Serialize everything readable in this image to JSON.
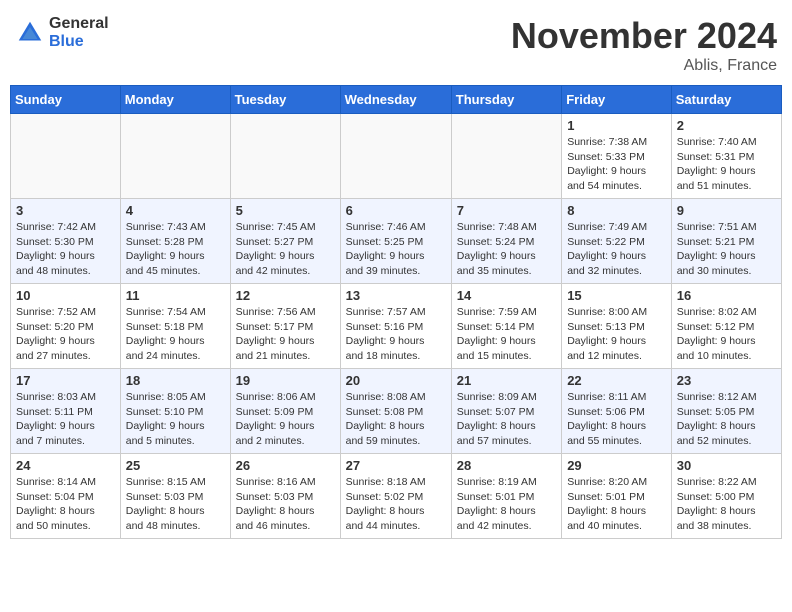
{
  "header": {
    "logo_general": "General",
    "logo_blue": "Blue",
    "month_title": "November 2024",
    "location": "Ablis, France"
  },
  "weekdays": [
    "Sunday",
    "Monday",
    "Tuesday",
    "Wednesday",
    "Thursday",
    "Friday",
    "Saturday"
  ],
  "weeks": [
    [
      {
        "day": "",
        "info": ""
      },
      {
        "day": "",
        "info": ""
      },
      {
        "day": "",
        "info": ""
      },
      {
        "day": "",
        "info": ""
      },
      {
        "day": "",
        "info": ""
      },
      {
        "day": "1",
        "info": "Sunrise: 7:38 AM\nSunset: 5:33 PM\nDaylight: 9 hours\nand 54 minutes."
      },
      {
        "day": "2",
        "info": "Sunrise: 7:40 AM\nSunset: 5:31 PM\nDaylight: 9 hours\nand 51 minutes."
      }
    ],
    [
      {
        "day": "3",
        "info": "Sunrise: 7:42 AM\nSunset: 5:30 PM\nDaylight: 9 hours\nand 48 minutes."
      },
      {
        "day": "4",
        "info": "Sunrise: 7:43 AM\nSunset: 5:28 PM\nDaylight: 9 hours\nand 45 minutes."
      },
      {
        "day": "5",
        "info": "Sunrise: 7:45 AM\nSunset: 5:27 PM\nDaylight: 9 hours\nand 42 minutes."
      },
      {
        "day": "6",
        "info": "Sunrise: 7:46 AM\nSunset: 5:25 PM\nDaylight: 9 hours\nand 39 minutes."
      },
      {
        "day": "7",
        "info": "Sunrise: 7:48 AM\nSunset: 5:24 PM\nDaylight: 9 hours\nand 35 minutes."
      },
      {
        "day": "8",
        "info": "Sunrise: 7:49 AM\nSunset: 5:22 PM\nDaylight: 9 hours\nand 32 minutes."
      },
      {
        "day": "9",
        "info": "Sunrise: 7:51 AM\nSunset: 5:21 PM\nDaylight: 9 hours\nand 30 minutes."
      }
    ],
    [
      {
        "day": "10",
        "info": "Sunrise: 7:52 AM\nSunset: 5:20 PM\nDaylight: 9 hours\nand 27 minutes."
      },
      {
        "day": "11",
        "info": "Sunrise: 7:54 AM\nSunset: 5:18 PM\nDaylight: 9 hours\nand 24 minutes."
      },
      {
        "day": "12",
        "info": "Sunrise: 7:56 AM\nSunset: 5:17 PM\nDaylight: 9 hours\nand 21 minutes."
      },
      {
        "day": "13",
        "info": "Sunrise: 7:57 AM\nSunset: 5:16 PM\nDaylight: 9 hours\nand 18 minutes."
      },
      {
        "day": "14",
        "info": "Sunrise: 7:59 AM\nSunset: 5:14 PM\nDaylight: 9 hours\nand 15 minutes."
      },
      {
        "day": "15",
        "info": "Sunrise: 8:00 AM\nSunset: 5:13 PM\nDaylight: 9 hours\nand 12 minutes."
      },
      {
        "day": "16",
        "info": "Sunrise: 8:02 AM\nSunset: 5:12 PM\nDaylight: 9 hours\nand 10 minutes."
      }
    ],
    [
      {
        "day": "17",
        "info": "Sunrise: 8:03 AM\nSunset: 5:11 PM\nDaylight: 9 hours\nand 7 minutes."
      },
      {
        "day": "18",
        "info": "Sunrise: 8:05 AM\nSunset: 5:10 PM\nDaylight: 9 hours\nand 5 minutes."
      },
      {
        "day": "19",
        "info": "Sunrise: 8:06 AM\nSunset: 5:09 PM\nDaylight: 9 hours\nand 2 minutes."
      },
      {
        "day": "20",
        "info": "Sunrise: 8:08 AM\nSunset: 5:08 PM\nDaylight: 8 hours\nand 59 minutes."
      },
      {
        "day": "21",
        "info": "Sunrise: 8:09 AM\nSunset: 5:07 PM\nDaylight: 8 hours\nand 57 minutes."
      },
      {
        "day": "22",
        "info": "Sunrise: 8:11 AM\nSunset: 5:06 PM\nDaylight: 8 hours\nand 55 minutes."
      },
      {
        "day": "23",
        "info": "Sunrise: 8:12 AM\nSunset: 5:05 PM\nDaylight: 8 hours\nand 52 minutes."
      }
    ],
    [
      {
        "day": "24",
        "info": "Sunrise: 8:14 AM\nSunset: 5:04 PM\nDaylight: 8 hours\nand 50 minutes."
      },
      {
        "day": "25",
        "info": "Sunrise: 8:15 AM\nSunset: 5:03 PM\nDaylight: 8 hours\nand 48 minutes."
      },
      {
        "day": "26",
        "info": "Sunrise: 8:16 AM\nSunset: 5:03 PM\nDaylight: 8 hours\nand 46 minutes."
      },
      {
        "day": "27",
        "info": "Sunrise: 8:18 AM\nSunset: 5:02 PM\nDaylight: 8 hours\nand 44 minutes."
      },
      {
        "day": "28",
        "info": "Sunrise: 8:19 AM\nSunset: 5:01 PM\nDaylight: 8 hours\nand 42 minutes."
      },
      {
        "day": "29",
        "info": "Sunrise: 8:20 AM\nSunset: 5:01 PM\nDaylight: 8 hours\nand 40 minutes."
      },
      {
        "day": "30",
        "info": "Sunrise: 8:22 AM\nSunset: 5:00 PM\nDaylight: 8 hours\nand 38 minutes."
      }
    ]
  ]
}
